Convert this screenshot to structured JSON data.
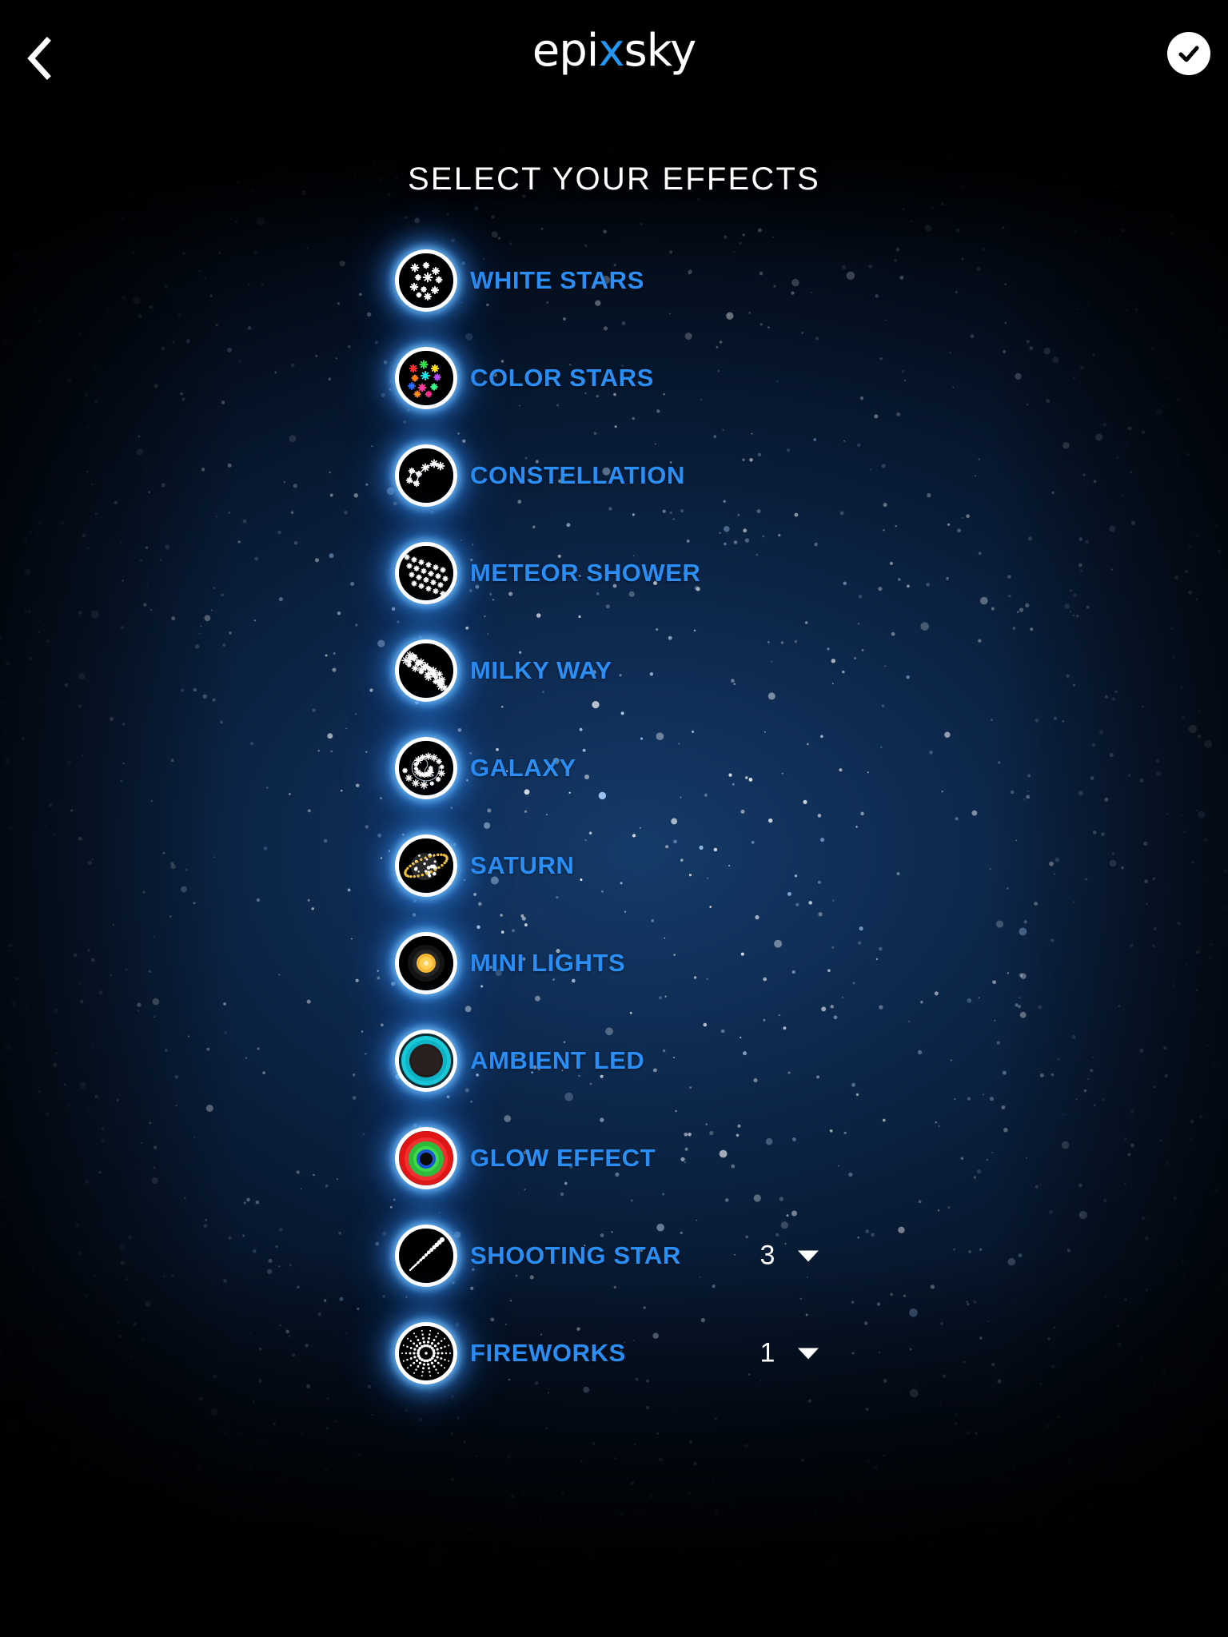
{
  "header": {
    "back_icon": "chevron-left-icon",
    "logo_text_1": "epi",
    "logo_accent": "x",
    "logo_text_2": "sky",
    "confirm_icon": "check-icon"
  },
  "page": {
    "title": "SELECT YOUR EFFECTS"
  },
  "colors": {
    "label_blue": "#2b8ef5",
    "logo_accent": "#2196f3",
    "glow": "#6ebeff",
    "background_top": "#000000",
    "background_mid": "#163e6e"
  },
  "effects": [
    {
      "label": "WHITE STARS",
      "icon": "white-stars-icon",
      "count": null
    },
    {
      "label": "COLOR STARS",
      "icon": "color-stars-icon",
      "count": null
    },
    {
      "label": "CONSTELLATION",
      "icon": "constellation-icon",
      "count": null
    },
    {
      "label": "METEOR SHOWER",
      "icon": "meteor-shower-icon",
      "count": null
    },
    {
      "label": "MILKY WAY",
      "icon": "milky-way-icon",
      "count": null
    },
    {
      "label": "GALAXY",
      "icon": "galaxy-icon",
      "count": null
    },
    {
      "label": "SATURN",
      "icon": "saturn-icon",
      "count": null
    },
    {
      "label": "MINI LIGHTS",
      "icon": "mini-lights-icon",
      "count": null
    },
    {
      "label": "AMBIENT LED",
      "icon": "ambient-led-icon",
      "count": null
    },
    {
      "label": "GLOW EFFECT",
      "icon": "glow-effect-icon",
      "count": null
    },
    {
      "label": "SHOOTING STAR",
      "icon": "shooting-star-icon",
      "count": "3"
    },
    {
      "label": "FIREWORKS",
      "icon": "fireworks-icon",
      "count": "1"
    }
  ]
}
